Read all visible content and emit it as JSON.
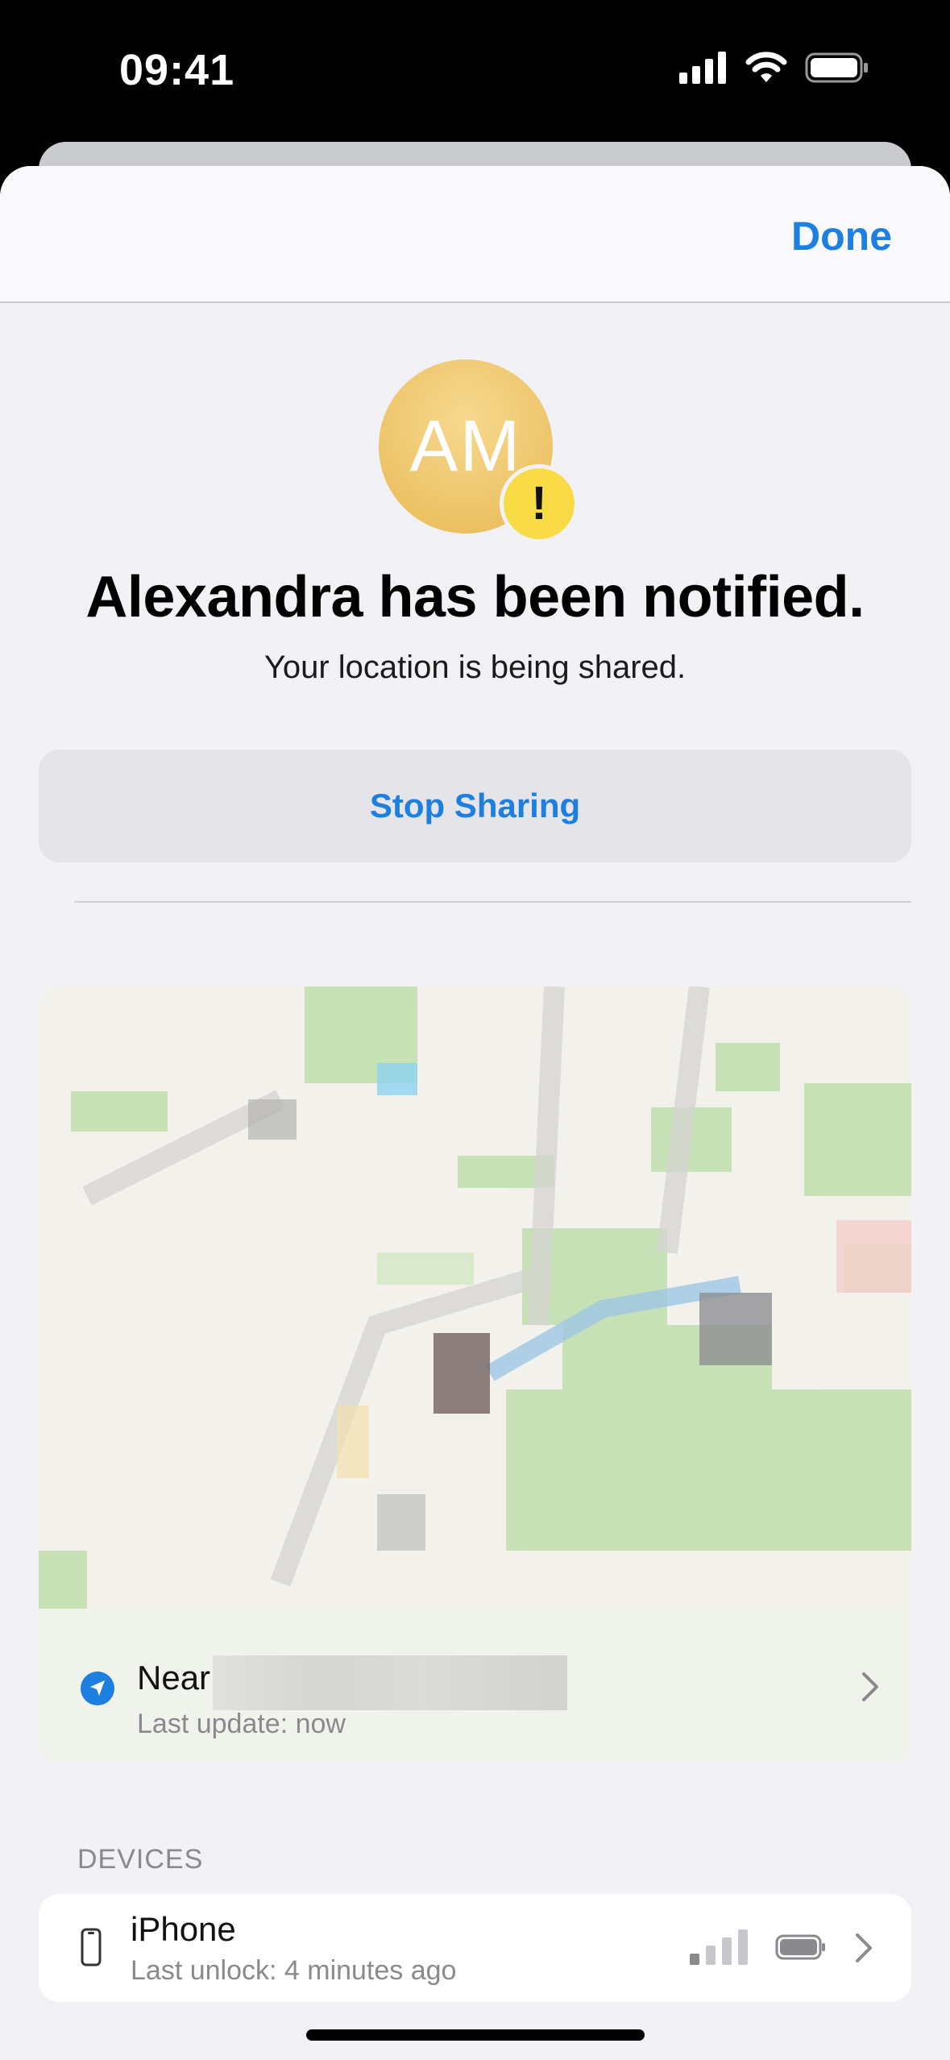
{
  "status_bar": {
    "time": "09:41"
  },
  "nav": {
    "done_label": "Done"
  },
  "contact": {
    "initials": "AM",
    "alert_mark": "!"
  },
  "notice": {
    "title": "Alexandra has been notified.",
    "subtitle": "Your location is being shared."
  },
  "actions": {
    "stop_sharing_label": "Stop Sharing"
  },
  "location": {
    "near_label": "Near",
    "last_update": "Last update: now"
  },
  "devices": {
    "header": "DEVICES",
    "items": [
      {
        "name": "iPhone",
        "detail": "Last unlock: 4 minutes ago"
      }
    ]
  },
  "colors": {
    "accent": "#1d7fe0",
    "avatar": "#f0c76b",
    "alert_badge": "#f9dc45",
    "background": "#f1f1f6"
  }
}
